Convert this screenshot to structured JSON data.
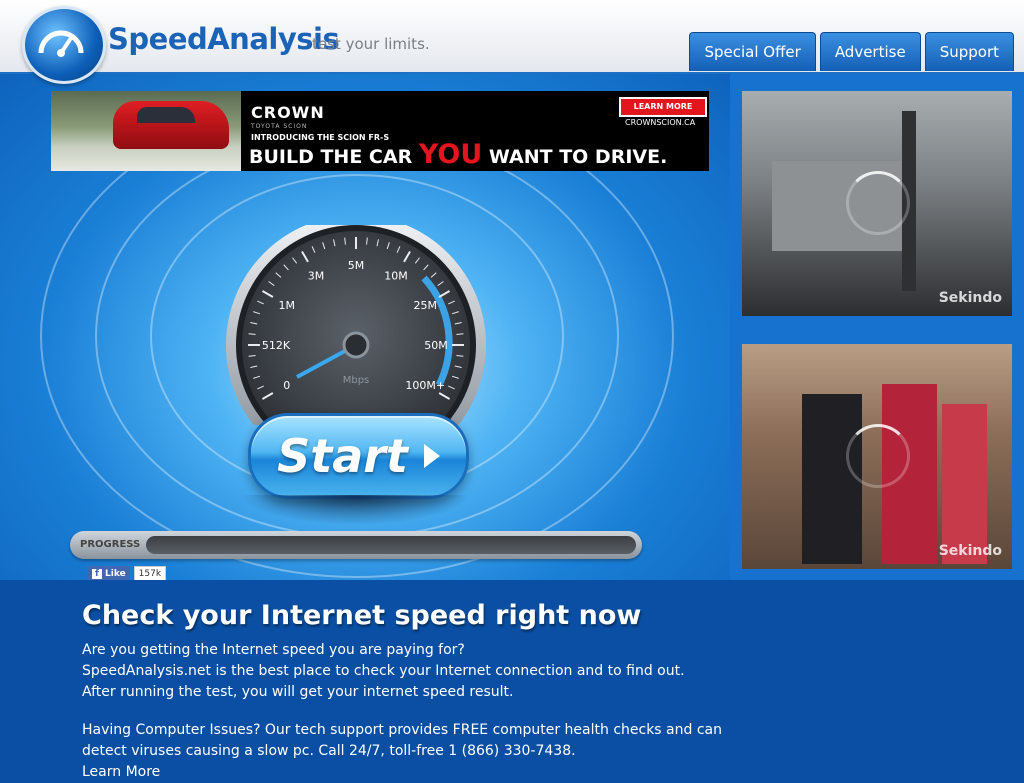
{
  "header": {
    "brand": "SpeedAnalysis",
    "tagline": "test your limits.",
    "nav": [
      "Special Offer",
      "Advertise",
      "Support"
    ]
  },
  "ad": {
    "brand": "CROWN",
    "brand_sub": "TOYOTA SCION",
    "intro": "INTRODUCING THE SCION FR-S",
    "headline_pre": "BUILD THE CAR ",
    "headline_you": "YOU",
    "headline_post": " WANT TO DRIVE.",
    "cta": "LEARN MORE",
    "url": "CROWNSCION.CA"
  },
  "gauge": {
    "ticks": [
      "0",
      "512K",
      "1M",
      "3M",
      "5M",
      "10M",
      "25M",
      "50M",
      "100M+"
    ],
    "unit": "Mbps"
  },
  "start_button": {
    "label": "Start"
  },
  "progress": {
    "label": "PROGRESS",
    "value": 0.0
  },
  "social": {
    "like_label": "Like",
    "like_count": "157k"
  },
  "videos": [
    {
      "watermark": "Sekindo"
    },
    {
      "watermark": "Sekindo"
    }
  ],
  "content": {
    "title": "Check your Internet speed right now",
    "paragraph1": [
      "Are you getting the Internet speed you are paying for?",
      "SpeedAnalysis.net is the best place to check your Internet connection and to find out.",
      "After running the test, you will get your internet speed result."
    ],
    "paragraph2": [
      "Having Computer Issues? Our tech support provides FREE computer health checks and can",
      "detect viruses causing a slow pc. Call 24/7, toll-free 1 (866) 330-7438.",
      "Learn More"
    ]
  },
  "colors": {
    "brand_blue": "#1a63b6",
    "content_bg": "#0a4fa3",
    "ad_red": "#e3161d"
  }
}
